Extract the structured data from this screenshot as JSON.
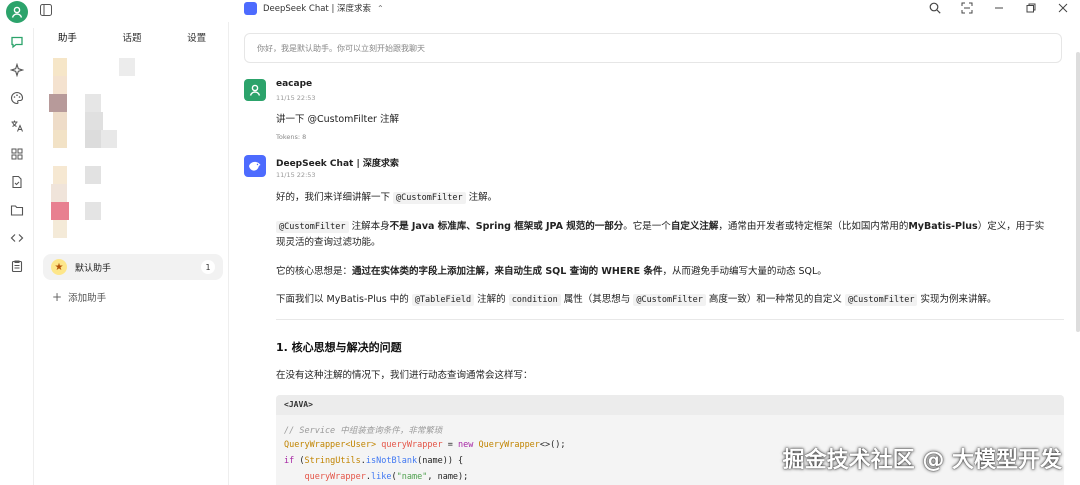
{
  "window": {
    "model_title": "DeepSeek Chat | 深度求索"
  },
  "panel": {
    "tabs": [
      "助手",
      "话题",
      "设置"
    ],
    "assistant": {
      "name": "默认助手",
      "count": "1"
    },
    "add_label": "添加助手"
  },
  "chat": {
    "system_placeholder": "你好，我是默认助手。你可以立刻开始跟我聊天",
    "user": {
      "name": "eacape",
      "time": "11/15 22:53",
      "text": "讲一下 @CustomFilter 注解",
      "tokens": "Tokens: 8"
    },
    "bot": {
      "name": "DeepSeek Chat | 深度求索",
      "time": "11/15 22:53",
      "p1_a": "好的，我们来详细讲解一下",
      "p1_code": "@CustomFilter",
      "p1_b": "注解。",
      "p2_code": "@CustomFilter",
      "p2_a": "注解本身",
      "p2_bold1": "不是 Java 标准库、Spring 框架或 JPA 规范的一部分",
      "p2_b": "。它是一个",
      "p2_bold2": "自定义注解",
      "p2_c": "，通常由开发者或特定框架（比如国内常用的",
      "p2_bold3": "MyBatis-Plus",
      "p2_d": "）定义，用于实",
      "p2_line2": "现灵活的查询过滤功能。",
      "p3_a": "它的核心思想是：",
      "p3_bold": "通过在实体类的字段上添加注解，来自动生成 SQL 查询的 WHERE 条件",
      "p3_b": "，从而避免手动编写大量的动态 SQL。",
      "p4_a": "下面我们以 MyBatis-Plus 中的",
      "p4_code1": "@TableField",
      "p4_b": "注解的",
      "p4_code2": "condition",
      "p4_c": "属性（其思想与",
      "p4_code3": "@CustomFilter",
      "p4_d": "高度一致）和一种常见的自定义",
      "p4_code4": "@CustomFilter",
      "p4_e": "实现为例来讲解。",
      "heading": "1. 核心思想与解决的问题",
      "p5": "在没有这种注解的情况下，我们进行动态查询通常会这样写：",
      "code_lang": "<JAVA>",
      "code": {
        "l1": "// Service 中组装查询条件，非常繁琐",
        "l2_type1": "QueryWrapper",
        "l2_gen": "<User>",
        "l2_var": " queryWrapper",
        "l2_eq": " = ",
        "l2_new": "new",
        "l2_type2": " QueryWrapper",
        "l2_end": "<>();",
        "l3_if": "if",
        "l3_a": " (",
        "l3_cls": "StringUtils",
        "l3_dot": ".",
        "l3_fn": "isNotBlank",
        "l3_b": "(name)) {",
        "l4_var": "    queryWrapper",
        "l4_dot": ".",
        "l4_fn": "like",
        "l4_a": "(",
        "l4_str": "\"name\"",
        "l4_b": ", name);"
      }
    }
  },
  "watermark": "掘金技术社区 @ 大模型开发",
  "colors": {
    "accent_green": "#2ca36b",
    "deepseek_blue": "#4d6bfe"
  }
}
